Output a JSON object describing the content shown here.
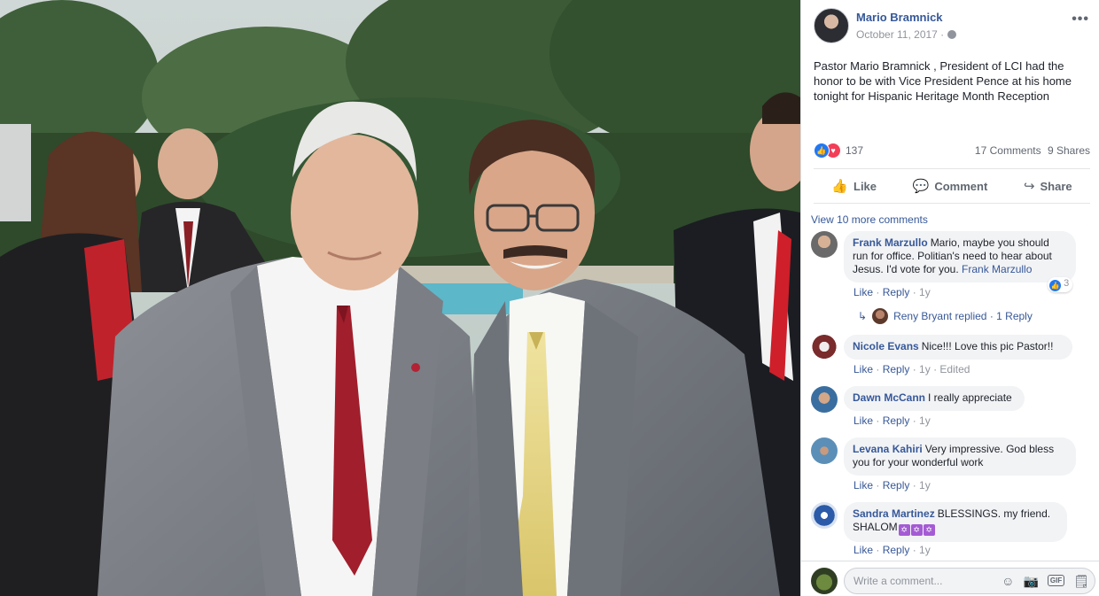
{
  "post": {
    "author": "Mario Bramnick",
    "date": "October 11, 2017 ·",
    "more": "•••",
    "text": "Pastor Mario Bramnick , President of LCI had the honor to be with Vice President Pence at his home tonight for Hispanic Heritage Month Reception",
    "reactions": {
      "like_icon": "👍",
      "love_icon": "♥",
      "count": "137"
    },
    "comments_count": "17 Comments",
    "shares_count": "9 Shares"
  },
  "actions": {
    "like": "Like",
    "comment": "Comment",
    "share": "Share"
  },
  "icons": {
    "like": "thumbs-up-icon",
    "comment": "speech-bubble-icon",
    "share": "share-arrow-icon",
    "globe": "globe-icon",
    "emoji": "smiley-icon",
    "camera": "camera-icon",
    "gif": "gif-icon",
    "sticker": "sticker-icon"
  },
  "comments": {
    "view_more": "View 10 more comments",
    "items": [
      {
        "name": "Frank Marzullo",
        "text": "Mario, maybe you should run for office. Politian's need to hear about Jesus. I'd vote for you.",
        "tag": "Frank Marzullo",
        "like": "Like",
        "reply": "Reply",
        "time": "1y",
        "reaction_count": "3"
      },
      {
        "name": "Nicole Evans",
        "text": "Nice!!! Love this pic Pastor!!",
        "like": "Like",
        "reply": "Reply",
        "time": "1y",
        "edited": "Edited"
      },
      {
        "name": "Dawn McCann",
        "text": "I really appreciate",
        "like": "Like",
        "reply": "Reply",
        "time": "1y"
      },
      {
        "name": "Levana Kahiri",
        "text": "Very impressive. God bless you for your wonderful work",
        "like": "Like",
        "reply": "Reply",
        "time": "1y"
      },
      {
        "name": "Sandra Martinez",
        "text": "BLESSINGS. my friend. SHALOM",
        "like": "Like",
        "reply": "Reply",
        "time": "1y"
      }
    ],
    "replies_line": {
      "name": "Reny Bryant",
      "action": "replied",
      "count": "· 1 Reply"
    }
  },
  "composer": {
    "placeholder": "Write a comment..."
  },
  "colors": {
    "link": "#365899",
    "meta": "#90949c",
    "bubble": "#f2f3f5",
    "like_blue": "#2078f4",
    "love_red": "#f33e58"
  }
}
